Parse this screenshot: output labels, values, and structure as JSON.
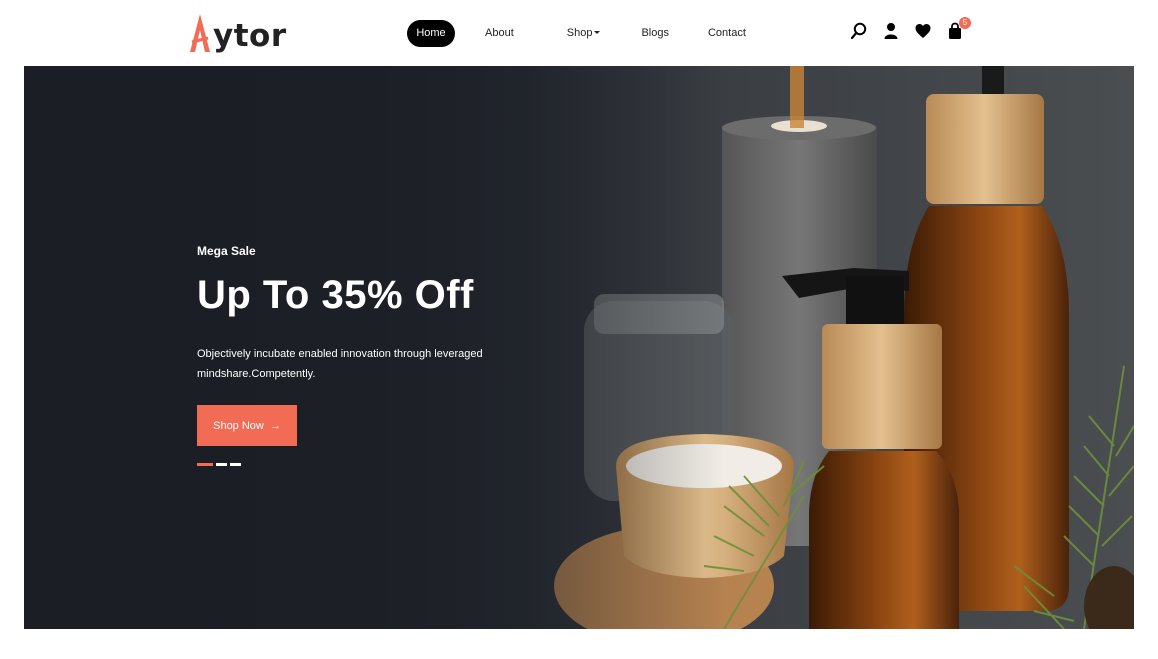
{
  "brand": {
    "name": "ytor",
    "accent": "#f26b54"
  },
  "nav": {
    "items": [
      {
        "label": "Home",
        "active": true
      },
      {
        "label": "About"
      },
      {
        "label": "Shop",
        "has_dropdown": true
      },
      {
        "label": "Blogs"
      },
      {
        "label": "Contact"
      }
    ]
  },
  "header_icons": {
    "search": "search-icon",
    "account": "user-icon",
    "wishlist": "heart-icon",
    "cart": "shopping-bag-icon",
    "cart_count": "5"
  },
  "hero": {
    "eyebrow": "Mega Sale",
    "headline": "Up To 35% Off",
    "description": "Objectively incubate enabled innovation through leveraged mindshare.Competently.",
    "cta_label": "Shop Now",
    "cta_icon": "arrow-right-icon",
    "slides_total": 3,
    "slide_active": 1
  }
}
